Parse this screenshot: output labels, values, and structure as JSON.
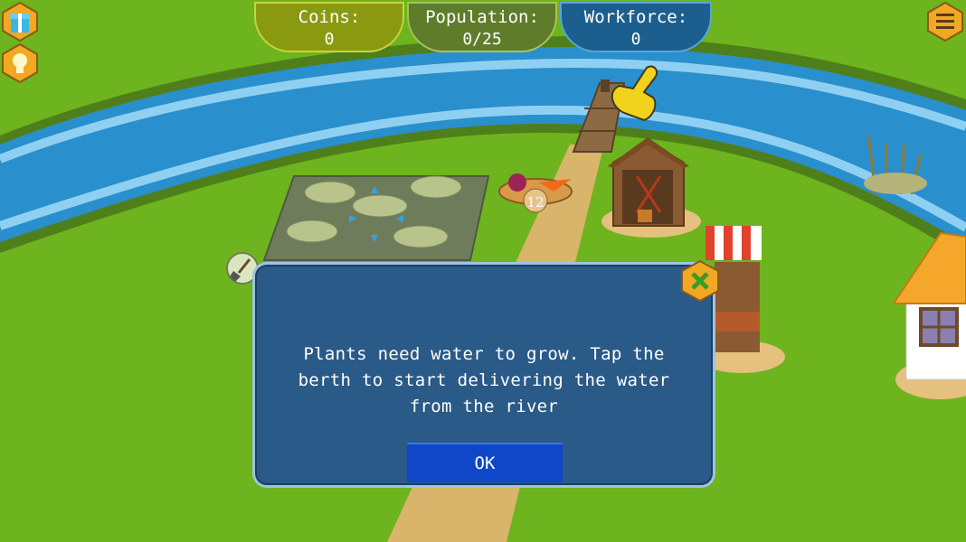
{
  "stats": {
    "coins": {
      "label": "Coins:",
      "value": "0"
    },
    "population": {
      "label": "Population:",
      "value": "0/25"
    },
    "workforce": {
      "label": "Workforce:",
      "value": "0"
    }
  },
  "scene": {
    "basket_count": "12"
  },
  "dialog": {
    "message": "Plants need water to grow. Tap the berth to start delivering the water from the river",
    "ok_label": "OK"
  },
  "icons": {
    "gift": "gift-icon",
    "hint": "lightbulb-icon",
    "menu": "menu-icon",
    "close": "close-icon",
    "shovel": "shovel-icon",
    "pointer": "pointing-hand-icon"
  },
  "colors": {
    "grass": "#6db41e",
    "river": "#2a8fcd",
    "path": "#d8b56a",
    "dialog_bg": "#2a5a87",
    "ok_button": "#0f47c8"
  }
}
